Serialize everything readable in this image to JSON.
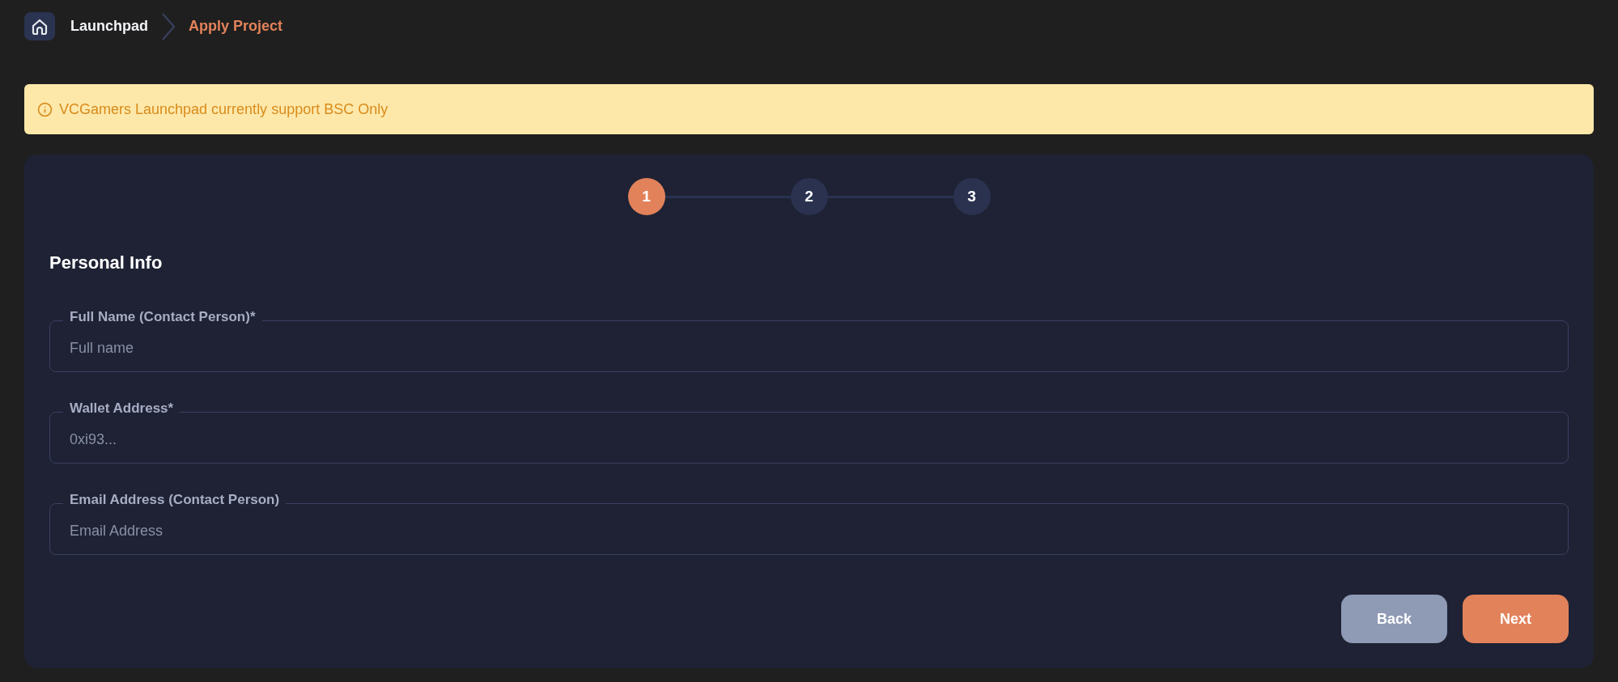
{
  "breadcrumb": [
    {
      "label": "Launchpad",
      "current": false
    },
    {
      "label": "Apply Project",
      "current": true
    }
  ],
  "alert": {
    "text": "VCGamers Launchpad currently support BSC Only"
  },
  "stepper": [
    {
      "label": "1",
      "selected": true
    },
    {
      "label": "2",
      "selected": false
    },
    {
      "label": "3",
      "selected": false
    }
  ],
  "section": {
    "title": "Personal Info"
  },
  "fields": [
    {
      "label": "Full Name (Contact Person)*",
      "placeholder": "Full name"
    },
    {
      "label": "Wallet Address*",
      "placeholder": "0xi93..."
    },
    {
      "label": "Email Address (Contact Person)",
      "placeholder": "Email Address"
    }
  ],
  "buttons": [
    {
      "label": "Back",
      "kind": "secondary"
    },
    {
      "label": "Next",
      "kind": "primary"
    }
  ]
}
